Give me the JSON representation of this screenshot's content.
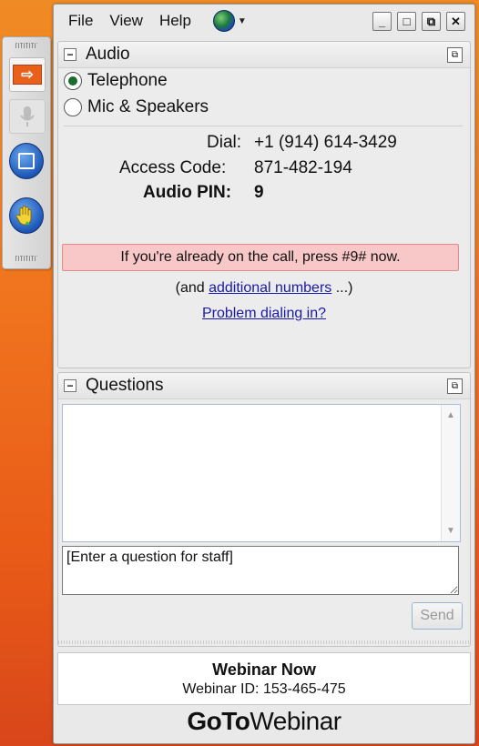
{
  "menu": {
    "file": "File",
    "view": "View",
    "help": "Help"
  },
  "window_controls": {
    "minimize": "_",
    "restore": "□",
    "popout": "⧉",
    "close": "✕"
  },
  "audio": {
    "title": "Audio",
    "options": {
      "telephone": "Telephone",
      "mic": "Mic & Speakers"
    },
    "selected": "Telephone",
    "dial_label": "Dial:",
    "dial_value": "+1 (914) 614-3429",
    "access_label": "Access Code:",
    "access_value": "871-482-194",
    "pin_label": "Audio PIN:",
    "pin_value": "9",
    "notice": "If you're already on the call, press #9# now.",
    "additional_prefix": "(and ",
    "additional_link": "additional numbers",
    "additional_suffix": " ...)",
    "problem_link": "Problem dialing in?"
  },
  "questions": {
    "title": "Questions",
    "input_placeholder": "[Enter a question for staff]",
    "send_label": "Send"
  },
  "webinar": {
    "name": "Webinar Now",
    "id_text": "Webinar ID: 153-465-475"
  },
  "logo": {
    "goto": "GoTo",
    "webinar": "Webinar"
  },
  "colors": {
    "notice_bg": "#f8c8c8",
    "link": "#1a1aa6",
    "arrow_orange": "#e8601a",
    "hand_blue": "#1d56b8"
  },
  "icons": [
    "grip-icon",
    "arrow-right-icon",
    "microphone-icon",
    "stop-square-icon",
    "raise-hand-icon",
    "globe-icon",
    "minimize-icon",
    "restore-icon",
    "popout-icon",
    "close-icon",
    "collapse-icon"
  ]
}
